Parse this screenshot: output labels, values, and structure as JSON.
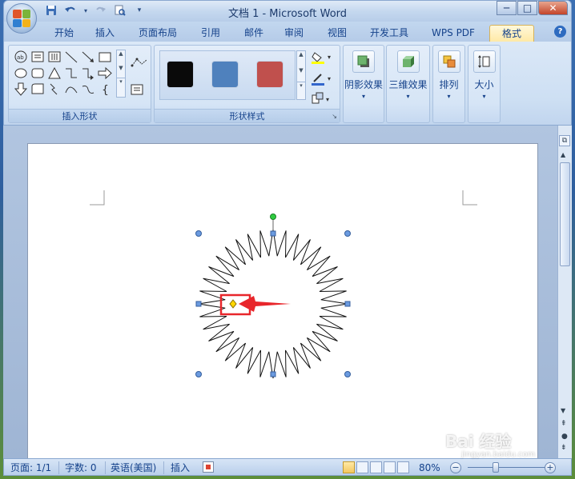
{
  "window": {
    "title": "文档 1 - Microsoft Word",
    "controls": {
      "minimize": "─",
      "maximize": "□",
      "close": "✕"
    }
  },
  "quick_access": [
    {
      "icon": "save-icon",
      "glyph": "💾"
    },
    {
      "icon": "undo-icon",
      "glyph": "↶"
    },
    {
      "icon": "redo-icon",
      "glyph": "↷"
    },
    {
      "icon": "print-preview-icon",
      "glyph": "🔍"
    },
    {
      "icon": "customize-dropdown-icon",
      "glyph": "▾"
    }
  ],
  "tabs": [
    {
      "label": "开始",
      "active": false
    },
    {
      "label": "插入",
      "active": false
    },
    {
      "label": "页面布局",
      "active": false
    },
    {
      "label": "引用",
      "active": false
    },
    {
      "label": "邮件",
      "active": false
    },
    {
      "label": "审阅",
      "active": false
    },
    {
      "label": "视图",
      "active": false
    },
    {
      "label": "开发工具",
      "active": false
    },
    {
      "label": "WPS PDF",
      "active": false
    },
    {
      "label": "格式",
      "active": true
    }
  ],
  "ribbon": {
    "insert_shapes": {
      "label": "插入形状"
    },
    "shape_styles": {
      "label": "形状样式",
      "swatches": [
        "#0a0a0a",
        "#4f81bd",
        "#c0504d"
      ]
    },
    "shadow": {
      "label": "阴影效果"
    },
    "threed": {
      "label": "三维效果"
    },
    "arrange": {
      "label": "排列"
    },
    "size": {
      "label": "大小"
    }
  },
  "status": {
    "page": "页面: 1/1",
    "words": "字数: 0",
    "language": "英语(美国)",
    "mode": "插入",
    "zoom": "80%"
  },
  "watermark": {
    "brand": "Bai 经验",
    "url": "jingyan.baidu.com"
  },
  "colors": {
    "accent": "#15428b",
    "highlight_box": "#e8262b",
    "handle": "#4f81bd",
    "rotate_handle": "#2ecc40",
    "adjust_handle": "#ffd700"
  }
}
